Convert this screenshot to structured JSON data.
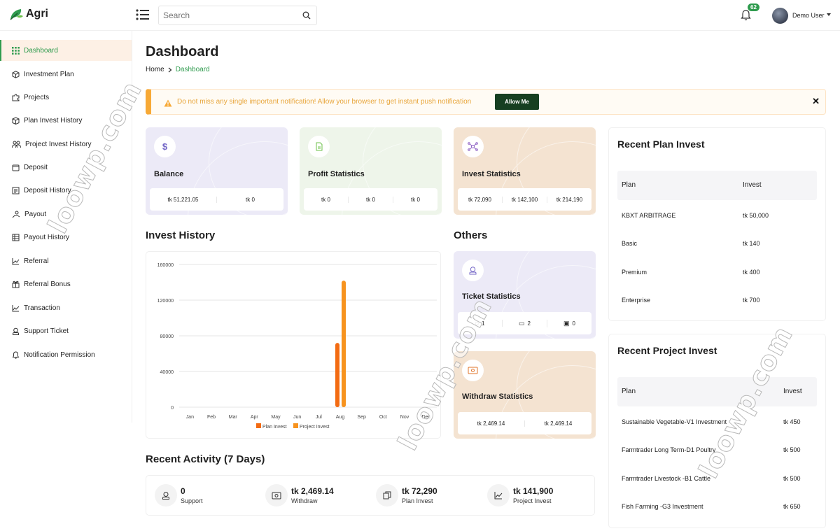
{
  "header": {
    "logo_text": "Agri",
    "search_placeholder": "Search",
    "notification_count": "62",
    "user_name": "Demo User"
  },
  "sidebar": {
    "items": [
      {
        "label": "Dashboard",
        "icon": "grid-icon",
        "active": true
      },
      {
        "label": "Investment Plan",
        "icon": "cube-icon"
      },
      {
        "label": "Projects",
        "icon": "puzzle-icon"
      },
      {
        "label": "Plan Invest History",
        "icon": "box-icon"
      },
      {
        "label": "Project Invest History",
        "icon": "users-icon"
      },
      {
        "label": "Deposit",
        "icon": "wallet-icon"
      },
      {
        "label": "Deposit History",
        "icon": "receipt-icon"
      },
      {
        "label": "Payout",
        "icon": "hand-coin-icon"
      },
      {
        "label": "Payout History",
        "icon": "table-icon"
      },
      {
        "label": "Referral",
        "icon": "chart-line-icon"
      },
      {
        "label": "Referral Bonus",
        "icon": "gift-icon"
      },
      {
        "label": "Transaction",
        "icon": "trend-icon"
      },
      {
        "label": "Support Ticket",
        "icon": "support-icon"
      },
      {
        "label": "Notification Permission",
        "icon": "bell-icon"
      }
    ]
  },
  "page": {
    "title": "Dashboard",
    "breadcrumb_home": "Home",
    "breadcrumb_current": "Dashboard"
  },
  "notice": {
    "text": "Do not miss any single important notification! Allow your browser to get instant push notification",
    "button": "Allow Me"
  },
  "cards": {
    "balance": {
      "title": "Balance",
      "values": [
        "tk 51,221.05",
        "tk 0"
      ]
    },
    "profit": {
      "title": "Profit Statistics",
      "values": [
        "tk 0",
        "tk 0",
        "tk 0"
      ]
    },
    "invest": {
      "title": "Invest Statistics",
      "values": [
        "tk 72,090",
        "tk 142,100",
        "tk 214,190"
      ]
    },
    "ticket": {
      "title": "Ticket Statistics",
      "values": [
        "1",
        "2",
        "0"
      ]
    },
    "withdraw": {
      "title": "Withdraw Statistics",
      "values": [
        "tk 2,469.14",
        "tk 2,469.14"
      ]
    }
  },
  "sections": {
    "invest_history": "Invest History",
    "others": "Others",
    "recent_activity": "Recent Activity (7 Days)"
  },
  "chart_data": {
    "type": "bar",
    "categories": [
      "Jan",
      "Feb",
      "Mar",
      "Apr",
      "May",
      "Jun",
      "Jul",
      "Aug",
      "Sep",
      "Oct",
      "Nov",
      "Dec"
    ],
    "series": [
      {
        "name": "Plan Invest",
        "color": "#f36b12",
        "values": [
          0,
          0,
          0,
          0,
          0,
          0,
          0,
          72090,
          0,
          0,
          0,
          0
        ]
      },
      {
        "name": "Project Invest",
        "color": "#f7931e",
        "values": [
          0,
          0,
          0,
          0,
          0,
          0,
          0,
          141900,
          0,
          0,
          0,
          0
        ]
      }
    ],
    "yticks": [
      "160000",
      "120000",
      "80000",
      "40000",
      "0"
    ],
    "ylim": [
      0,
      160000
    ],
    "grid": true,
    "legend": "bottom"
  },
  "recent_plan": {
    "title": "Recent Plan Invest",
    "columns": [
      "Plan",
      "Invest"
    ],
    "rows": [
      [
        "KBXT ARBITRAGE",
        "tk 50,000"
      ],
      [
        "Basic",
        "tk 140"
      ],
      [
        "Premium",
        "tk 400"
      ],
      [
        "Enterprise",
        "tk 700"
      ]
    ]
  },
  "recent_project": {
    "title": "Recent Project Invest",
    "columns": [
      "Plan",
      "Invest"
    ],
    "rows": [
      [
        "Sustainable Vegetable-V1 Investment",
        "tk 450"
      ],
      [
        "Farmtrader Long Term-D1 Poultry",
        "tk 500"
      ],
      [
        "Farmtrader Livestock -B1 Cattle",
        "tk 500"
      ],
      [
        "Fish Farming -G3 Investment",
        "tk 650"
      ]
    ]
  },
  "activity": [
    {
      "value": "0",
      "label": "Support",
      "icon": "support-icon"
    },
    {
      "value": "tk 2,469.14",
      "label": "Withdraw",
      "icon": "cash-icon"
    },
    {
      "value": "tk 72,290",
      "label": "Plan Invest",
      "icon": "copy-icon"
    },
    {
      "value": "tk 141,900",
      "label": "Project Invest",
      "icon": "trend-icon"
    }
  ],
  "watermark": "loowp.com",
  "colors": {
    "brand": "#2f9b4e",
    "accent": "#f7931e",
    "notice": "#f7a936",
    "allow_btn": "#163f21"
  }
}
